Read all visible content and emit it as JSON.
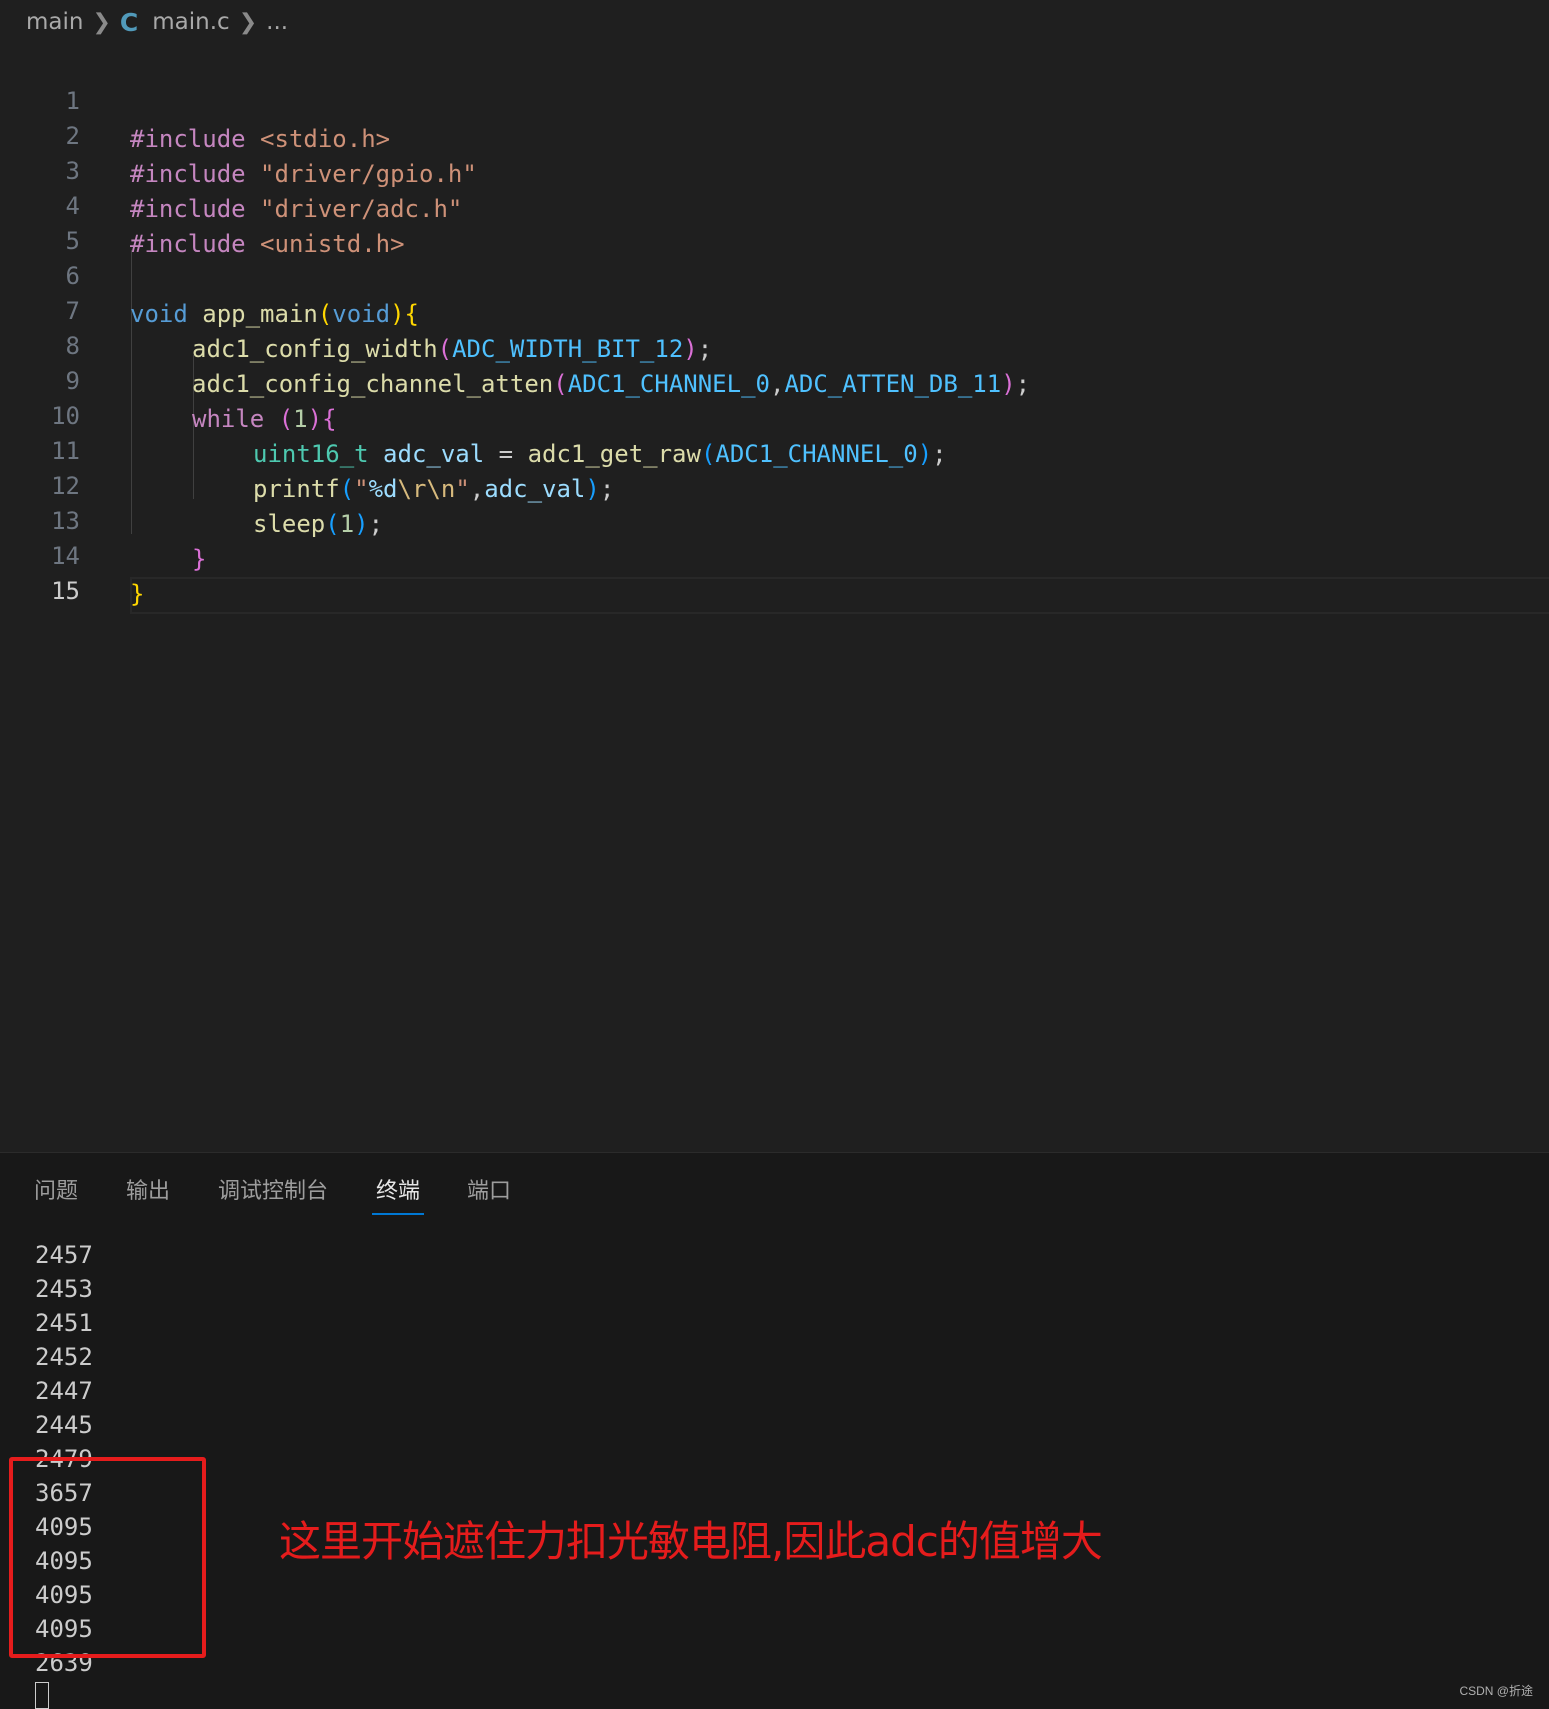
{
  "breadcrumb": {
    "folder": "main",
    "file_icon": "C",
    "file": "main.c",
    "more": "..."
  },
  "editor": {
    "line_numbers": [
      "1",
      "2",
      "3",
      "4",
      "5",
      "6",
      "7",
      "8",
      "9",
      "10",
      "11",
      "12",
      "13",
      "14",
      "15"
    ],
    "active_line": "15",
    "code": {
      "l1": {
        "inc": "#include",
        "sp": " ",
        "hdr": "<stdio.h>"
      },
      "l2": {
        "inc": "#include",
        "sp": " ",
        "hdr": "\"driver/gpio.h\""
      },
      "l3": {
        "inc": "#include",
        "sp": " ",
        "hdr": "\"driver/adc.h\""
      },
      "l4": {
        "inc": "#include",
        "sp": " ",
        "hdr": "<unistd.h>"
      },
      "l6": {
        "void1": "void",
        "sp": " ",
        "fn": "app_main",
        "po": "(",
        "void2": "void",
        "pc": ")",
        "bo": "{"
      },
      "l7": {
        "fn": "adc1_config_width",
        "po": "(",
        "arg": "ADC_WIDTH_BIT_12",
        "pc": ")",
        "semi": ";"
      },
      "l8": {
        "fn": "adc1_config_channel_atten",
        "po": "(",
        "arg1": "ADC1_CHANNEL_0",
        "comma": ",",
        "arg2": "ADC_ATTEN_DB_11",
        "pc": ")",
        "semi": ";"
      },
      "l9": {
        "kw": "while",
        "sp": " ",
        "po": "(",
        "num": "1",
        "pc": ")",
        "bo": "{"
      },
      "l10": {
        "type": "uint16_t",
        "sp": " ",
        "var": "adc_val",
        "eq": " = ",
        "fn": "adc1_get_raw",
        "po": "(",
        "arg": "ADC1_CHANNEL_0",
        "pc": ")",
        "semi": ";"
      },
      "l11": {
        "fn": "printf",
        "po": "(",
        "q1": "\"",
        "fmt": "%d",
        "esc": "\\r\\n",
        "q2": "\"",
        "comma": ",",
        "var": "adc_val",
        "pc": ")",
        "semi": ";"
      },
      "l12": {
        "fn": "sleep",
        "po": "(",
        "num": "1",
        "pc": ")",
        "semi": ";"
      },
      "l13": {
        "bc": "}"
      },
      "l14": {
        "bc": "}"
      }
    }
  },
  "panel": {
    "tabs": [
      "问题",
      "输出",
      "调试控制台",
      "终端",
      "端口"
    ],
    "active_tab": "终端",
    "terminal_lines": [
      "2457",
      "2453",
      "2451",
      "2452",
      "2447",
      "2445",
      "2479",
      "3657",
      "4095",
      "4095",
      "4095",
      "4095",
      "2639"
    ]
  },
  "annotation": {
    "text": "这里开始遮住力扣光敏电阻,因此adc的值增大",
    "color": "#e51c1c"
  },
  "watermark": "CSDN @折途"
}
